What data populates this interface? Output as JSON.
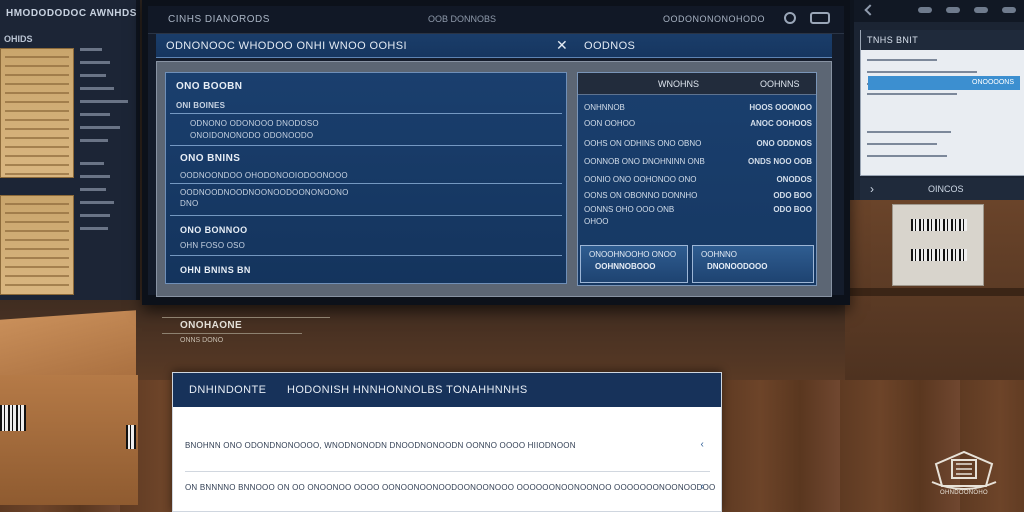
{
  "left_monitor": {
    "title": "HMODODODOC AWNHDS",
    "subtitle": "OHIDS"
  },
  "main_monitor": {
    "topbar": {
      "title": "CINHS DIANORODS",
      "status": "OOB DONNOBS",
      "right_title": "OODONONONOHODO"
    },
    "dialog": {
      "title": "ODNONOOC WHODOO ONHI WNOO OOHSI",
      "close_icon": "✕",
      "right_title": "OODNOS"
    },
    "left_pane": {
      "sections": [
        {
          "header": "ONO BOOBN",
          "sub": "ONI BOINES",
          "lines": [
            "ODNONO ODONOOO DNODOSO",
            "ONOIDONONODO ODONOODO"
          ]
        },
        {
          "header": "ONO BNINS",
          "sub": "",
          "lines": [
            "OODNOONDOO OHODONOOIODOONOOO",
            "OODNOODNOODNOONOODOONONOONO",
            "DNO"
          ]
        },
        {
          "header": "ONO BONNOO",
          "sub": "OHN FOSO OSO",
          "lines": []
        },
        {
          "header": "OHN BNINS BN",
          "sub": "",
          "lines": []
        }
      ]
    },
    "right_pane": {
      "header_left": "WNOHNS",
      "header_right": "OOHNNS",
      "rows": [
        {
          "key": "ONHNNOB",
          "value": "HOOS OOONOO"
        },
        {
          "key": "OON OOHOO",
          "value": "ANOC OOHOOS"
        },
        {
          "key": "OOHS ON ODHINS ONO OBNO",
          "value": "ONO ODDNOS"
        },
        {
          "key": "OONNOB ONO DNOHNINN ONB",
          "value": "ONDS NOO OOB"
        },
        {
          "key": "OONIO ONO OOHONOO ONO",
          "value": "ONODOS"
        },
        {
          "key": "OONS ON OBONNO DONNHO",
          "value": "ODO BOO"
        },
        {
          "key": "OONNS OHO OOO ONB",
          "value": "ODO BOO"
        },
        {
          "key": "OHOO",
          "value": ""
        }
      ],
      "buttons": [
        {
          "label": "ONOOHNOOHO ONOO",
          "sub": "OOHNNOBOOO"
        },
        {
          "label": "OOHNNO",
          "sub": "DNONOODOOO"
        }
      ]
    }
  },
  "right_monitor": {
    "panel_title": "TNHS BNIT",
    "highlight_text": "ONOOOONS",
    "footer_label": "OINCOS",
    "footer_arrow": "›"
  },
  "note_panel": {
    "title": "ONOHAONE",
    "sub": "ONNS DONO"
  },
  "bottom_card": {
    "tabs": [
      "DNHINDONTE",
      "HODONISH HNNHONNOLBS TONAHHNNHS"
    ],
    "rows": [
      {
        "text": "BNOHNN ONO ODONDNONOOOO, WNODNONODN DNOODNONOODN OONNO OOOO HIIODNOON"
      },
      {
        "text": "ON BNNNNO BNNOOO ON OO ONOONOO OOOO OONOONOONOODOONOONOOO OOOOOONOONOONOO OOOOOOONOONOODOO"
      }
    ],
    "chevron_icon": "‹"
  },
  "emblem_text": "OHNDOONOHO"
}
